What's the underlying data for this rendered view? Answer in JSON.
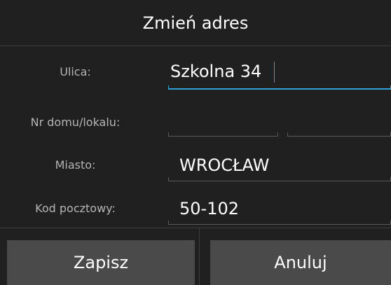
{
  "dialog": {
    "title": "Zmień adres"
  },
  "fields": {
    "street": {
      "label": "Ulica:",
      "value": "Szkolna 34",
      "focused": true
    },
    "house_number": {
      "label": "Nr domu/lokalu:",
      "house_value": "",
      "apartment_value": ""
    },
    "city": {
      "label": "Miasto:",
      "value": "WROCŁAW"
    },
    "postal_code": {
      "label": "Kod pocztowy:",
      "value": "50-102"
    }
  },
  "buttons": {
    "save_label": "Zapisz",
    "cancel_label": "Anuluj"
  },
  "colors": {
    "background": "#202020",
    "button": "#4a4a4a",
    "accent": "#2f9fd6",
    "label": "#b4b4b4",
    "divider": "#3d3d3d"
  }
}
